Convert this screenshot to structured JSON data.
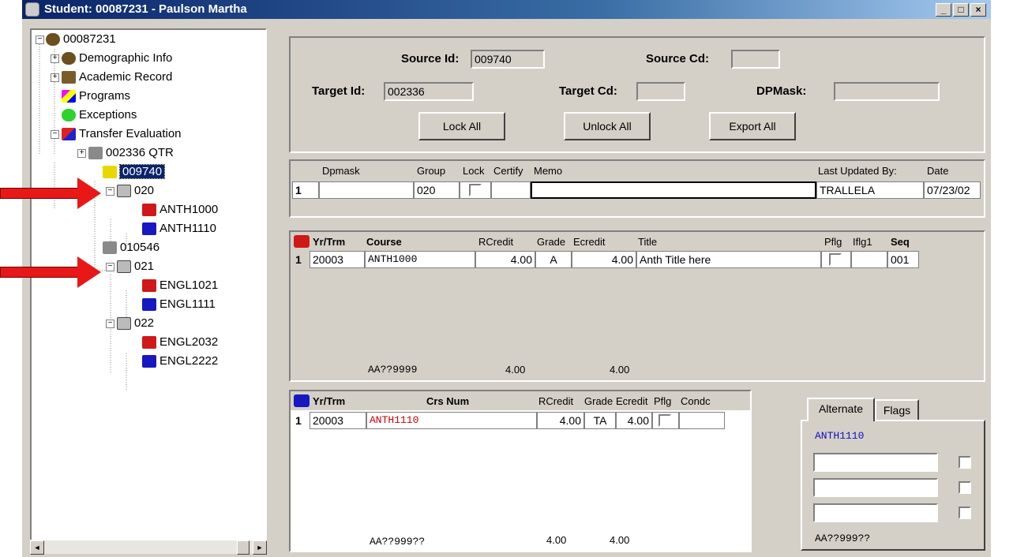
{
  "window": {
    "title": "Student: 00087231 - Paulson Martha",
    "min_label": "_",
    "max_label": "□",
    "close_label": "×"
  },
  "tree": {
    "root": "00087231",
    "demographic": "Demographic Info",
    "academic": "Academic Record",
    "programs": "Programs",
    "exceptions": "Exceptions",
    "transfer": "Transfer Evaluation",
    "inst1": "002336  QTR",
    "inst2": "009740",
    "grp020": "020",
    "anth1000": "ANTH1000",
    "anth1110": "ANTH1110",
    "inst3": "010546",
    "grp021": "021",
    "engl1021": "ENGL1021",
    "engl1111": "ENGL1111",
    "grp022": "022",
    "engl2032": "ENGL2032",
    "engl2222": "ENGL2222"
  },
  "header": {
    "source_id_label": "Source Id:",
    "source_id": "009740",
    "source_cd_label": "Source Cd:",
    "source_cd": "",
    "target_id_label": "Target Id:",
    "target_id": "002336",
    "target_cd_label": "Target Cd:",
    "target_cd": "",
    "dpmask_label": "DPMask:",
    "dpmask": "",
    "lock_all": "Lock All",
    "unlock_all": "Unlock All",
    "export_all": "Export All"
  },
  "mask_grid": {
    "cols": [
      "Dpmask",
      "Group",
      "Lock",
      "Certify",
      "Memo",
      "Last Updated By:",
      "Date"
    ],
    "row_num": "1",
    "group": "020",
    "updated_by": "TRALLELA",
    "date": "07/23/02"
  },
  "source_grid": {
    "cols": [
      "Yr/Trm",
      "Course",
      "RCredit",
      "Grade",
      "Ecredit",
      "Title",
      "Pflg",
      "Iflg1",
      "Seq"
    ],
    "row_num": "1",
    "yrtrm": "20003",
    "course": "ANTH1000",
    "rcredit": "4.00",
    "grade": "A",
    "ecredit": "4.00",
    "title": "Anth Title here",
    "seq": "001",
    "footer_course": "AA??9999",
    "footer_rcredit": "4.00",
    "footer_ecredit": "4.00"
  },
  "target_grid": {
    "cols": [
      "Yr/Trm",
      "Crs Num",
      "RCredit",
      "Grade",
      "Ecredit",
      "Pflg",
      "Condc"
    ],
    "row_num": "1",
    "yrtrm": "20003",
    "crsnum": "ANTH1110",
    "rcredit": "4.00",
    "grade": "TA",
    "ecredit": "4.00",
    "footer_course": "AA??999??",
    "footer_rcredit": "4.00",
    "footer_ecredit": "4.00"
  },
  "tabs": {
    "alternate": "Alternate",
    "flags": "Flags",
    "alt_course": "ANTH1110",
    "footer": "AA??999??"
  },
  "colors": {
    "title_bar": "#0a246a",
    "selected": "#0a246a",
    "red_course": "#cc0000",
    "blue_course": "#1010c0",
    "arrow": "#e81818"
  }
}
